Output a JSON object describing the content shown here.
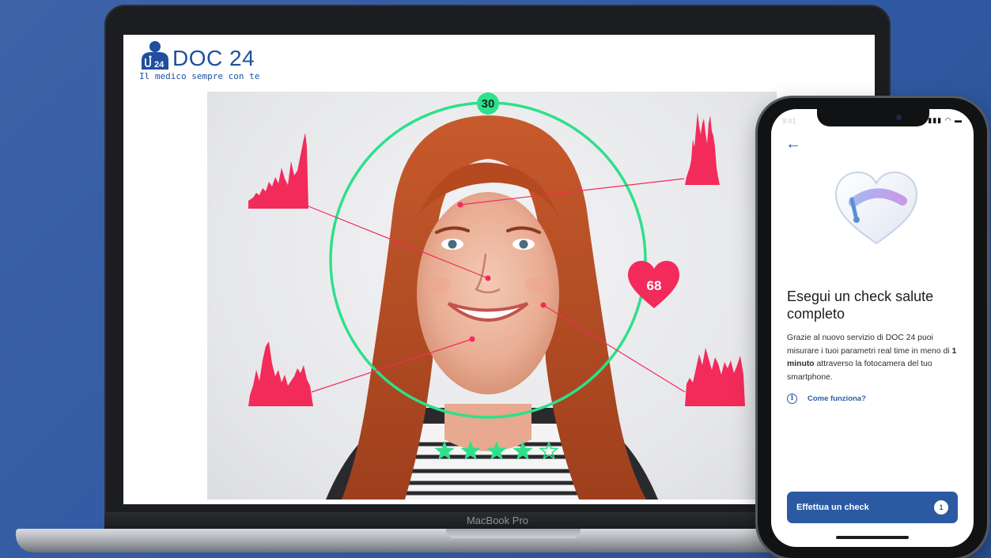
{
  "laptop": {
    "brand_label": "MacBook Pro",
    "app": {
      "logo_name": "DOC 24",
      "logo_tagline": "Il medico sempre con te",
      "logo_badge": "24"
    },
    "scan": {
      "countdown": "30",
      "heart_rate": "68",
      "rating": {
        "filled": 4,
        "total": 5
      }
    },
    "colors": {
      "ring": "#2ee08a",
      "marker": "#f22b5b",
      "star": "#2ee08a"
    }
  },
  "phone": {
    "status_time": "9:41",
    "status_icons": "▮▮▮ ◠ ▬",
    "back_icon": "arrow-left-icon",
    "title": "Esegui un check salute completo",
    "body_before": "Grazie al nuovo servizio di DOC 24 puoi misurare i tuoi parametri real time in meno di ",
    "body_bold": "1 minuto",
    "body_after": " attraverso la fotocamera del tuo smartphone.",
    "info_icon_glyph": "i",
    "info_link": "Come funziona?",
    "cta_label": "Effettua un check",
    "cta_badge": "1",
    "accent": "#2b5aa3"
  }
}
